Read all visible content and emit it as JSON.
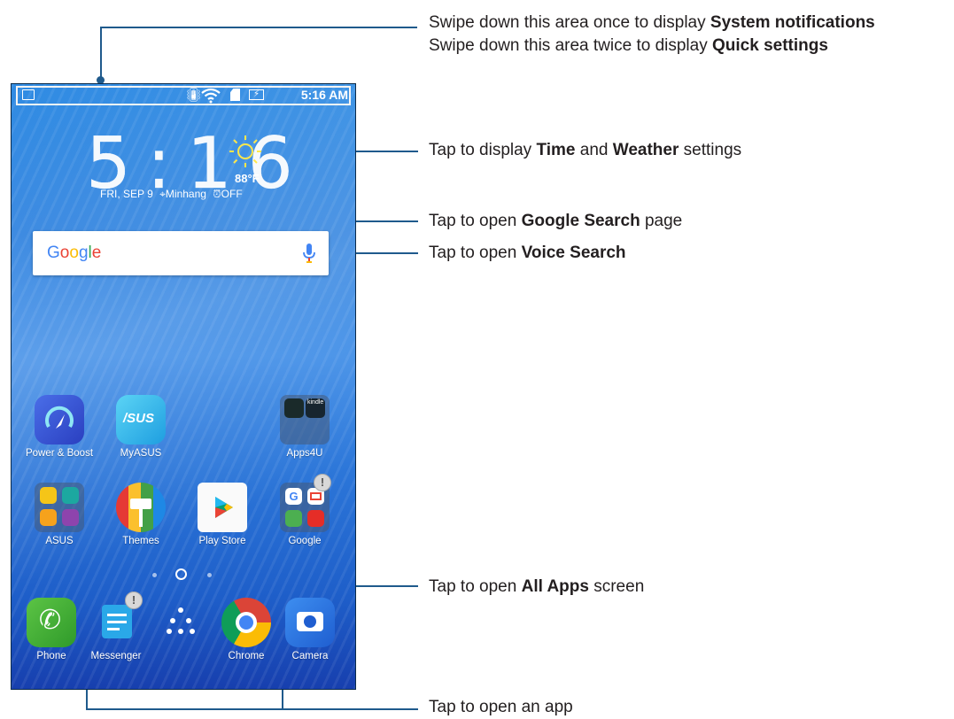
{
  "callouts": {
    "status_line1_prefix": "Swipe down this area once to display ",
    "status_line1_bold": "System notifications",
    "status_line2_prefix": "Swipe down this area twice to display ",
    "status_line2_bold": "Quick settings",
    "clock_prefix": "Tap to display ",
    "clock_bold1": "Time",
    "clock_mid": " and ",
    "clock_bold2": "Weather",
    "clock_suffix": " settings",
    "google_prefix": "Tap to open ",
    "google_bold": "Google Search",
    "google_suffix": " page",
    "voice_prefix": "Tap to open ",
    "voice_bold": "Voice Search",
    "allapps_prefix": "Tap to open ",
    "allapps_bold": "All Apps",
    "allapps_suffix": " screen",
    "openapp": "Tap to open an app"
  },
  "statusbar": {
    "time": "5:16 AM"
  },
  "clock": {
    "time": "5:16",
    "date": "FRI, SEP 9",
    "location": "Minhang",
    "alarm": "OFF",
    "temperature": "88°F"
  },
  "search": {
    "logo": "Google"
  },
  "apps_row1": [
    {
      "label": "Power & Boost"
    },
    {
      "label": "MyASUS"
    },
    {
      "label": "Apps4U"
    }
  ],
  "apps_row2": [
    {
      "label": "ASUS"
    },
    {
      "label": "Themes"
    },
    {
      "label": "Play Store"
    },
    {
      "label": "Google"
    }
  ],
  "dock": [
    {
      "label": "Phone"
    },
    {
      "label": "Messenger"
    },
    {
      "label": "Chrome"
    },
    {
      "label": "Camera"
    }
  ],
  "asus_logo": "/SUS",
  "kindle_text": "kindle",
  "badge_symbol": "!",
  "colors": {
    "callout_line": "#1f5a8c",
    "google_blue": "#4285f4",
    "google_red": "#ea4335",
    "google_yellow": "#fbbc05",
    "google_green": "#34a853"
  }
}
